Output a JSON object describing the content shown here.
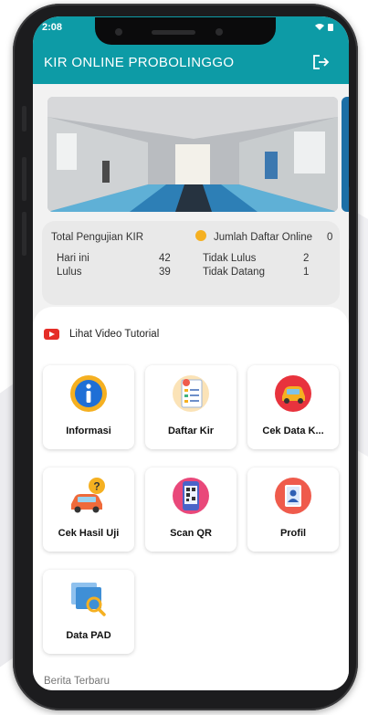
{
  "status_bar": {
    "time": "2:08"
  },
  "app_bar": {
    "title": "KIR ONLINE PROBOLINGGO"
  },
  "stats": {
    "total_label": "Total Pengujian KIR",
    "online_label": "Jumlah Daftar Online",
    "online_value": "0",
    "rows": [
      {
        "left_label": "Hari ini",
        "left_value": "42",
        "right_label": "Tidak Lulus",
        "right_value": "2"
      },
      {
        "left_label": "Lulus",
        "left_value": "39",
        "right_label": "Tidak Datang",
        "right_value": "1"
      }
    ]
  },
  "video": {
    "label": "Lihat Video Tutorial"
  },
  "menu": [
    {
      "label": "Informasi",
      "icon": "info-icon"
    },
    {
      "label": "Daftar Kir",
      "icon": "form-icon"
    },
    {
      "label": "Cek Data K...",
      "icon": "car-check-icon"
    },
    {
      "label": "Cek Hasil Uji",
      "icon": "car-question-icon"
    },
    {
      "label": "Scan QR",
      "icon": "qr-scan-icon"
    },
    {
      "label": "Profil",
      "icon": "profile-icon"
    },
    {
      "label": "Data PAD",
      "icon": "data-search-icon"
    }
  ],
  "news": {
    "title": "Berita Terbaru"
  },
  "colors": {
    "primary": "#0d9ba6",
    "accent": "#f5b021",
    "youtube": "#e52d27"
  }
}
